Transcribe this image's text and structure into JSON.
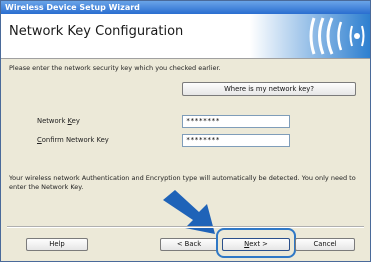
{
  "window": {
    "title": "Wireless Device Setup Wizard"
  },
  "header": {
    "title": "Network Key Configuration"
  },
  "instruction": "Please enter the network security key which you checked earlier.",
  "where_button": "Where is my network key?",
  "fields": {
    "network_key": {
      "label_prefix": "Network ",
      "label_key": "K",
      "label_suffix": "ey",
      "value": "********"
    },
    "confirm_key": {
      "label_key": "C",
      "label_rest": "onfirm Network Key",
      "value": "********"
    }
  },
  "info_text": "Your wireless network Authentication and Encryption type will automatically be detected. You only need to enter the Network Key.",
  "buttons": {
    "help": "Help",
    "back": "< Back",
    "next_key": "N",
    "next_rest": "ext >",
    "cancel": "Cancel"
  },
  "colors": {
    "title_bar": "#2a6ed0",
    "highlight": "#2f78c6",
    "arrow": "#1f63b8"
  }
}
